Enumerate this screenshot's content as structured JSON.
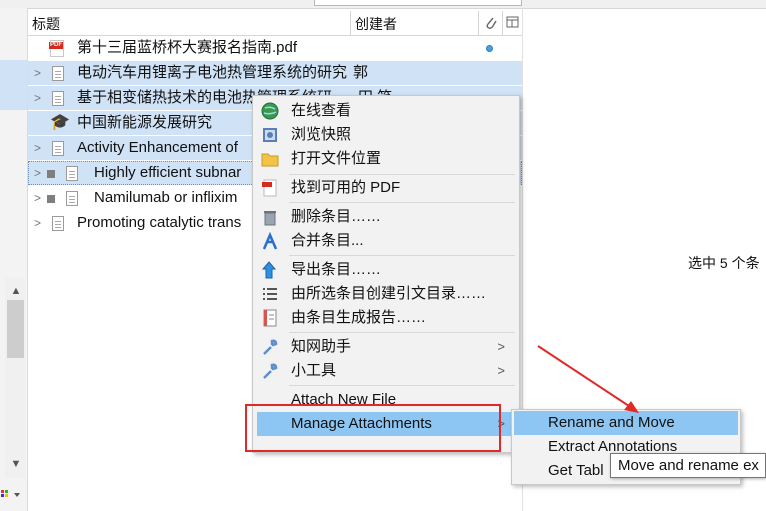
{
  "columns": {
    "title": "标题",
    "creator": "创建者"
  },
  "rows": [
    {
      "title": "第十三届蓝桥杯大赛报名指南.pdf",
      "creator": "",
      "icon": "pdf-icon"
    },
    {
      "title": "电动汽车用锂离子电池热管理系统的研究",
      "creator": "郭",
      "icon": "document-icon"
    },
    {
      "title": "基于相变储热技术的电池热管理系统研",
      "creator": "田 笑",
      "icon": "document-icon"
    },
    {
      "title": "中国新能源发展研究",
      "creator": "",
      "icon": "thesis-icon"
    },
    {
      "title": "Activity Enhancement of",
      "creator": "",
      "icon": "document-icon"
    },
    {
      "title": "Highly efficient subnar",
      "creator": "",
      "icon": "document-icon"
    },
    {
      "title": "Namilumab or inflixim",
      "creator": "",
      "icon": "document-icon"
    },
    {
      "title": "Promoting catalytic trans",
      "creator": "",
      "icon": "document-icon"
    }
  ],
  "selection_info": "选中 5 个条",
  "menu": {
    "view_online": "在线查看",
    "view_snapshot": "浏览快照",
    "open_location": "打开文件位置",
    "find_pdf": "找到可用的 PDF",
    "delete_items": "删除条目……",
    "merge_items": "合并条目...",
    "export_items": "导出条目……",
    "create_bibliography": "由所选条目创建引文目录……",
    "generate_report": "由条目生成报告……",
    "cnki_helper": "知网助手",
    "tools": "小工具",
    "attach_new_file": "Attach New File",
    "manage_attachments": "Manage Attachments"
  },
  "submenu": {
    "rename_move": "Rename and Move",
    "extract_annotations": "Extract Annotations",
    "get_table": "Get Tabl"
  },
  "tooltip": "Move and rename ex",
  "colors": {
    "highlight": "#8ec6f3",
    "selection": "#cfe2f6",
    "annotation_red": "#e02a2a"
  }
}
